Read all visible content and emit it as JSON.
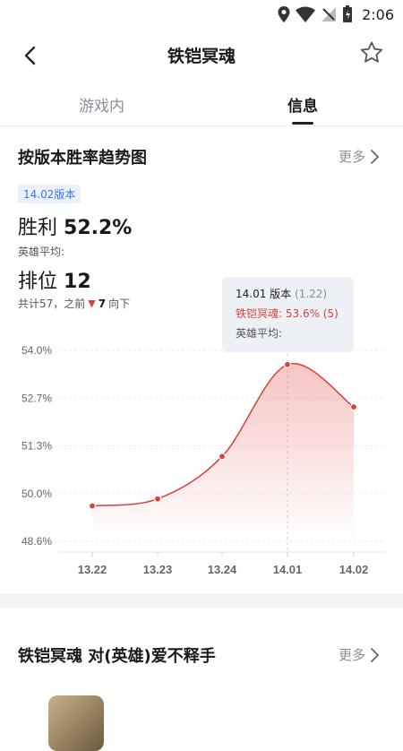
{
  "status_bar": {
    "time": "2:06"
  },
  "header": {
    "title": "铁铠冥魂"
  },
  "tabs": [
    {
      "label": "游戏内"
    },
    {
      "label": "信息"
    }
  ],
  "trend": {
    "section_title": "按版本胜率趋势图",
    "more_label": "更多",
    "version_badge": "14.02版本",
    "win_label": "胜利",
    "win_value": "52.2%",
    "hero_avg_label": "英雄平均:",
    "rank_label": "排位",
    "rank_value": "12",
    "rank_total": "共计57，之前",
    "rank_change_icon": "▼",
    "rank_change": "7",
    "rank_dir": "向下"
  },
  "tooltip": {
    "version": "14.01 版本",
    "count": "(1.22)",
    "hero_line": "铁铠冥魂: 53.6% (5)",
    "avg_line": "英雄平均:"
  },
  "chart_data": {
    "type": "line",
    "categories": [
      "13.22",
      "13.23",
      "13.24",
      "14.01",
      "14.02"
    ],
    "series": [
      {
        "values": [
          49.6,
          49.8,
          51.0,
          53.6,
          52.4
        ],
        "color": "#d9423a"
      }
    ],
    "ytick_labels": [
      "54.0%",
      "52.7%",
      "51.3%",
      "50.0%",
      "48.6%"
    ],
    "ylim": [
      48.6,
      54.0
    ],
    "highlight_category": "14.01",
    "grid": true
  },
  "matchup": {
    "section_title": "铁铠冥魂 对(英雄)爱不释手",
    "more_label": "更多"
  },
  "colors": {
    "accent_blue": "#3b78e7",
    "line_red": "#d9423a"
  }
}
